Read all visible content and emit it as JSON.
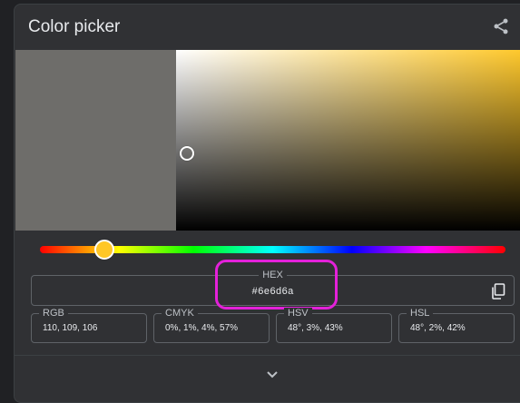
{
  "header": {
    "title": "Color picker",
    "share_icon": "share-icon"
  },
  "colors": {
    "selected": "#6e6d6a",
    "hue_color": "#ffc726",
    "highlight": "#e321d9"
  },
  "hue_slider": {
    "value_degrees": 48
  },
  "hex": {
    "label": "HEX",
    "value": "#6e6d6a",
    "copy_icon": "copy-icon"
  },
  "fields": {
    "rgb": {
      "label": "RGB",
      "value": "110, 109, 106"
    },
    "cmyk": {
      "label": "CMYK",
      "value": "0%, 1%, 4%, 57%"
    },
    "hsv": {
      "label": "HSV",
      "value": "48°, 3%, 43%"
    },
    "hsl": {
      "label": "HSL",
      "value": "48°, 2%, 42%"
    }
  },
  "footer": {
    "expand_icon": "chevron-down-icon"
  }
}
